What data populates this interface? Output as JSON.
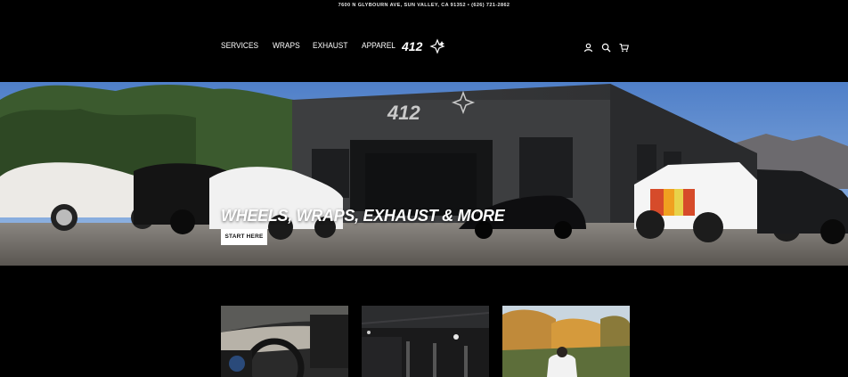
{
  "announcement": "7600 N GLYBOURN AVE, SUN VALLEY, CA 91352 • (626) 721-2862",
  "nav": {
    "items": [
      {
        "label": "SERVICES"
      },
      {
        "label": "WRAPS"
      },
      {
        "label": "EXHAUST"
      },
      {
        "label": "APPAREL"
      }
    ]
  },
  "logo": {
    "text": "412"
  },
  "header_icons": [
    "account-icon",
    "search-icon",
    "cart-icon"
  ],
  "hero": {
    "title": "WHEELS, WRAPS, EXHAUST & MORE",
    "cta": "START HERE"
  },
  "cards": [
    {
      "name": "interior-card"
    },
    {
      "name": "shop-card"
    },
    {
      "name": "outdoor-card"
    }
  ],
  "colors": {
    "background": "#000000",
    "button_bg": "#ffffff",
    "button_text": "#111111"
  }
}
